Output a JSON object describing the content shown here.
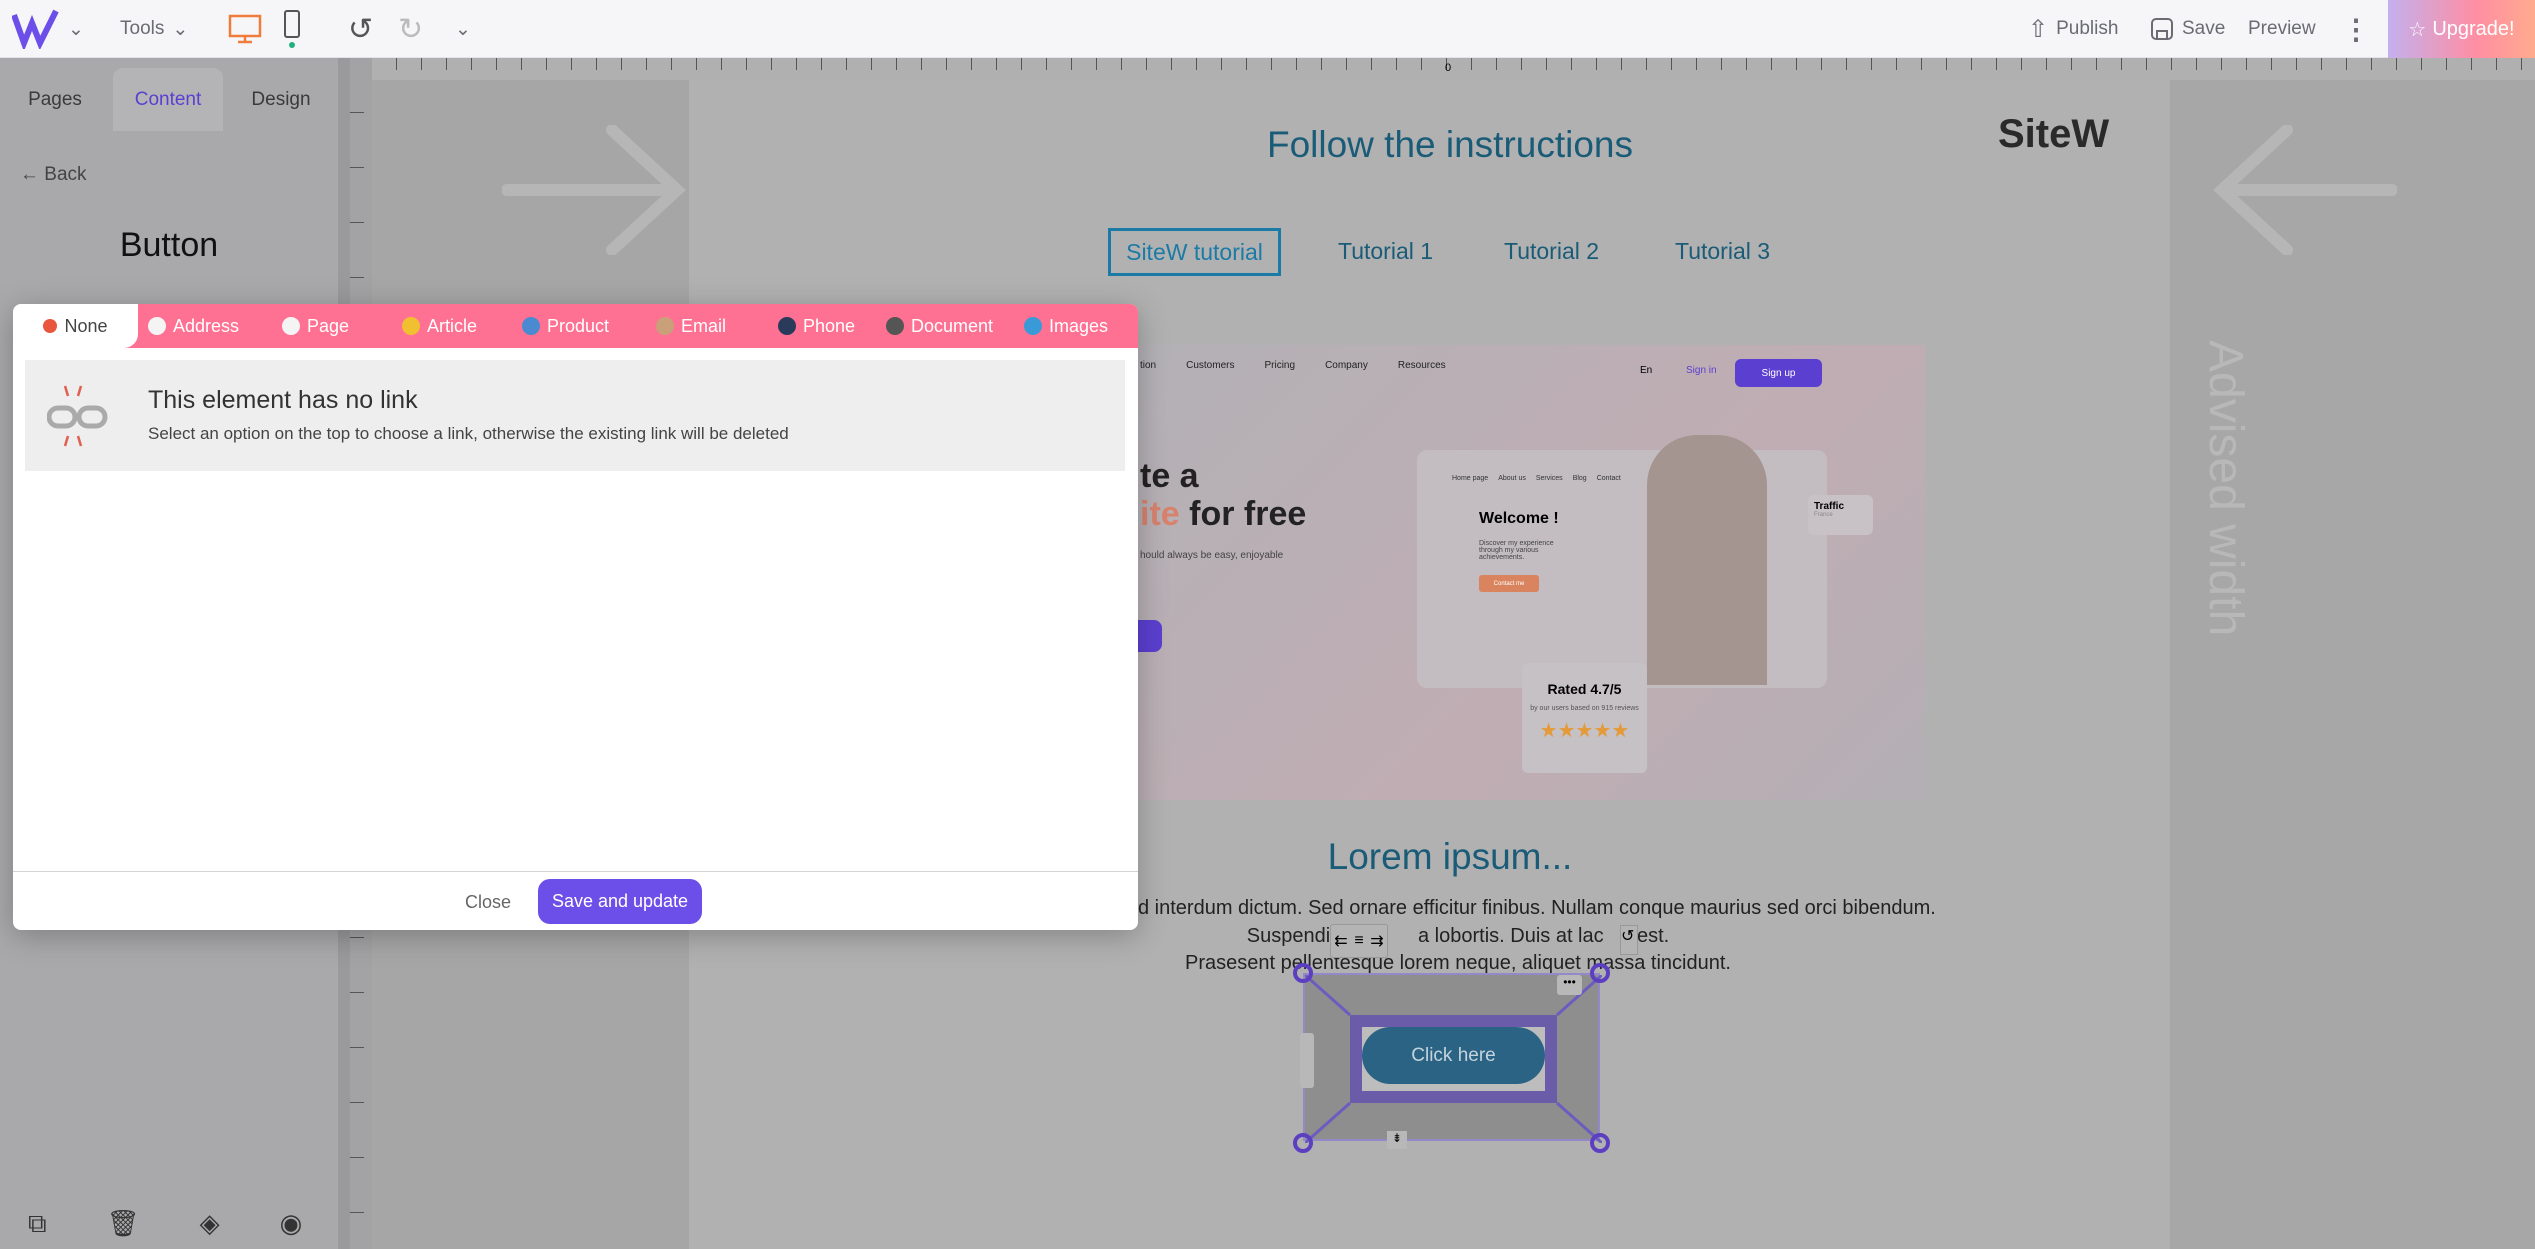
{
  "topbar": {
    "tools": "Tools",
    "publish": "Publish",
    "save": "Save",
    "preview": "Preview",
    "upgrade": "Upgrade!"
  },
  "sidebar": {
    "tabs": [
      "Pages",
      "Content",
      "Design"
    ],
    "active_tab": "Content",
    "back": "Back",
    "title": "Button"
  },
  "ruler": {
    "origin": "0"
  },
  "canvas": {
    "heading": "Follow the instructions",
    "logo": "SiteW",
    "nav": [
      "SiteW tutorial",
      "Tutorial 1",
      "Tutorial 2",
      "Tutorial 3"
    ],
    "hero": {
      "nav": [
        "tion",
        "Customers",
        "Pricing",
        "Company",
        "Resources"
      ],
      "lang": "En",
      "signin": "Sign in",
      "signup": "Sign up",
      "title_1": "te a",
      "title_2a": "ite",
      "title_2b": " for free",
      "sub": "hould always be easy, enjoyable",
      "mock_nav": [
        "Home page",
        "About us",
        "Services",
        "Blog",
        "Contact"
      ],
      "welcome": "Welcome !",
      "discover": "Discover my experience through my various achievements.",
      "contact": "Contact me",
      "traffic": "Traffic",
      "traffic_sub": "France",
      "rated": "Rated 4.7/5",
      "reviews": "by our users based on 915 reviews",
      "stars": 5
    },
    "lorem_title": "Lorem ipsum...",
    "lorem_lines": [
      "d interdum dictum. Sed ornare efficitur finibus. Nullam conque maurius sed orci bibendum.",
      "Suspendise f          a lobortis. Duis at lac   a est.",
      "Prasesent pellentesque lorem neque, aliquet massa tincidunt."
    ],
    "button_label": "Click here",
    "advised_width": "Advised width"
  },
  "modal": {
    "tabs": [
      {
        "label": "None",
        "icon": "close-circle-icon"
      },
      {
        "label": "Address",
        "icon": "link-icon"
      },
      {
        "label": "Page",
        "icon": "page-icon"
      },
      {
        "label": "Article",
        "icon": "article-icon"
      },
      {
        "label": "Product",
        "icon": "cart-icon"
      },
      {
        "label": "Email",
        "icon": "email-icon"
      },
      {
        "label": "Phone",
        "icon": "phone-icon"
      },
      {
        "label": "Document",
        "icon": "floppy-icon"
      },
      {
        "label": "Images",
        "icon": "image-icon"
      }
    ],
    "active_tab": "None",
    "title": "This element has no link",
    "description": "Select an option on the top to choose a link, otherwise the existing link will be deleted",
    "close": "Close",
    "save": "Save and update"
  },
  "colors": {
    "accent": "#6c4fe8",
    "tabbar": "#ff7193",
    "heading": "#1a5b78",
    "button": "#2b6384"
  }
}
